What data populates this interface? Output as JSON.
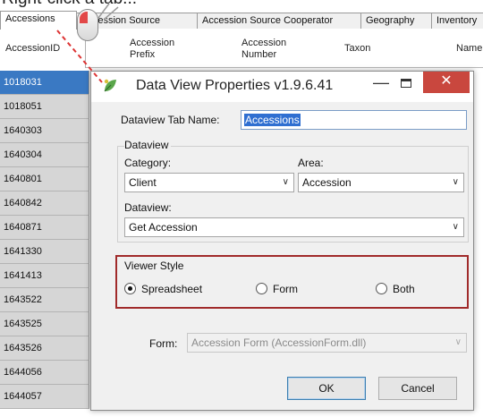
{
  "caption": "Right-click a tab...",
  "tabs": [
    "Accessions",
    "Accession Source",
    "Accession Source Cooperator",
    "Geography",
    "Inventory"
  ],
  "columns": [
    "AccessionID",
    "Accession Prefix",
    "Accession Number",
    "Taxon",
    "Name"
  ],
  "rows": [
    "1018031",
    "1018051",
    "1640303",
    "1640304",
    "1640801",
    "1640842",
    "1640871",
    "1641330",
    "1641413",
    "1643522",
    "1643525",
    "1643526",
    "1644056",
    "1644057"
  ],
  "selected_row": "1018031",
  "dialog": {
    "title": "Data View Properties v1.9.6.41",
    "tab_name_label": "Dataview Tab Name:",
    "tab_name_value": "Accessions",
    "dataview_group": "Dataview",
    "category_label": "Category:",
    "category_value": "Client",
    "area_label": "Area:",
    "area_value": "Accession",
    "dataview_label": "Dataview:",
    "dataview_value": "Get Accession",
    "viewer_style_label": "Viewer Style",
    "radio_spreadsheet": "Spreadsheet",
    "radio_form": "Form",
    "radio_both": "Both",
    "selected_style": "Spreadsheet",
    "form_label": "Form:",
    "form_value": "Accession Form  (AccessionForm.dll)",
    "ok_label": "OK",
    "cancel_label": "Cancel",
    "minimize_glyph": "—",
    "close_glyph": "✕"
  },
  "colors": {
    "selected_row": "#3a79c3",
    "close_button": "#c9473e",
    "highlight_box": "#a02a2a",
    "text_selection": "#2f6fd1"
  }
}
